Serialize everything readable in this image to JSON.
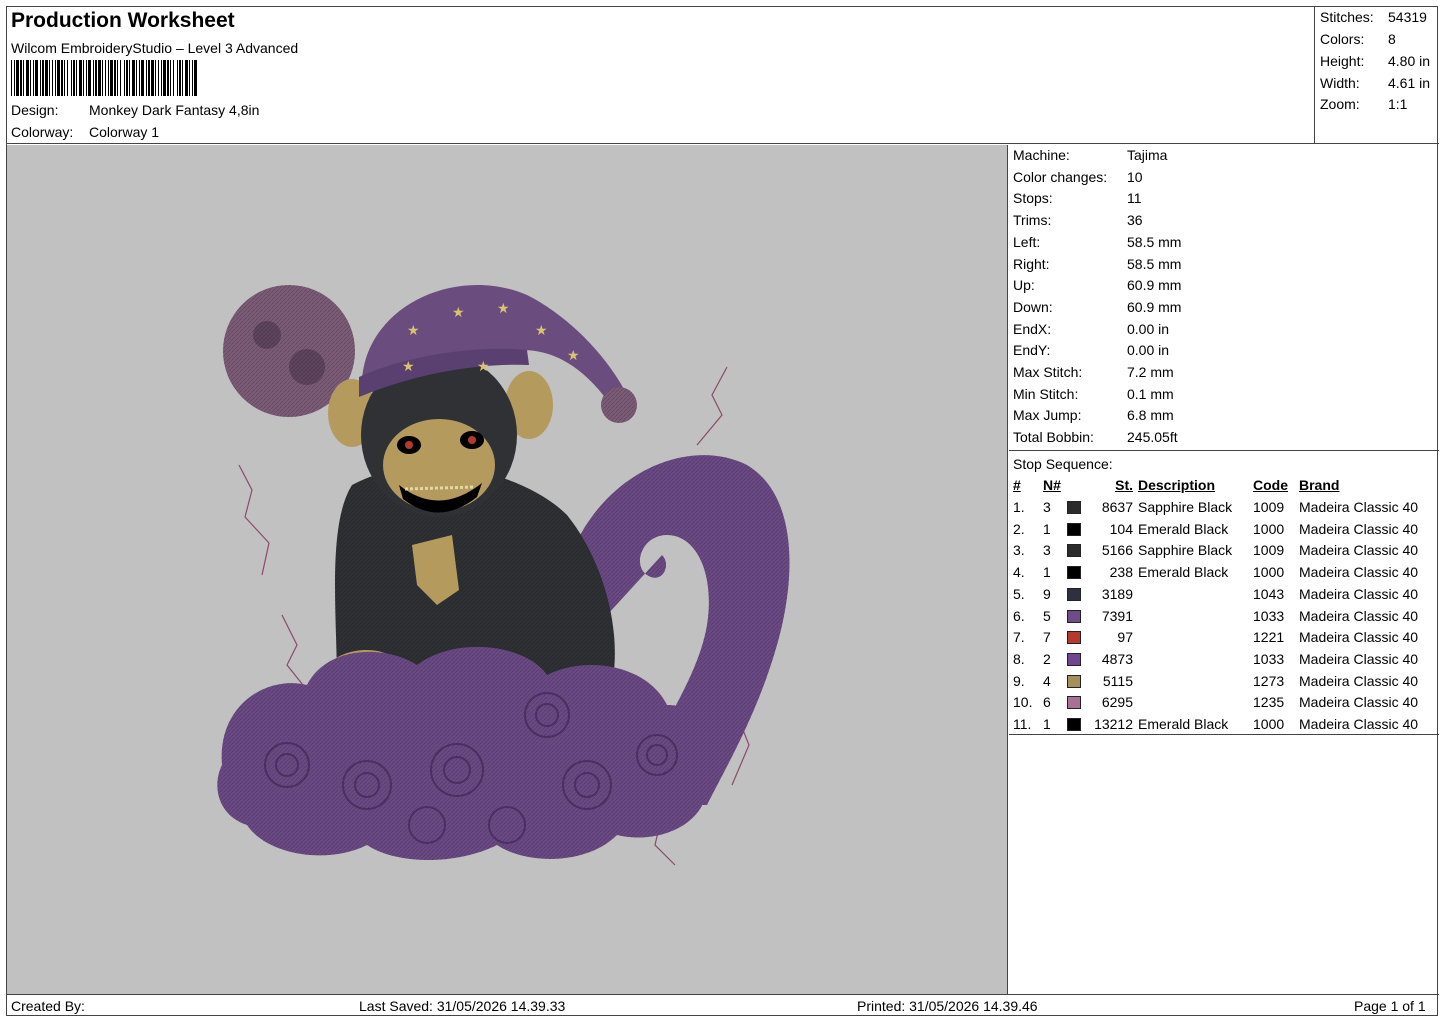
{
  "header": {
    "title": "Production Worksheet",
    "software": "Wilcom EmbroideryStudio – Level 3 Advanced",
    "design_label": "Design:",
    "design_value": "Monkey Dark Fantasy 4,8in",
    "colorway_label": "Colorway:",
    "colorway_value": "Colorway 1"
  },
  "summary": [
    {
      "label": "Stitches:",
      "value": "54319"
    },
    {
      "label": "Colors:",
      "value": "8"
    },
    {
      "label": "Height:",
      "value": "4.80 in"
    },
    {
      "label": "Width:",
      "value": "4.61 in"
    },
    {
      "label": "Zoom:",
      "value": "1:1"
    }
  ],
  "machine": [
    {
      "label": "Machine:",
      "value": "Tajima"
    },
    {
      "label": "Color changes:",
      "value": "10"
    },
    {
      "label": "Stops:",
      "value": "11"
    },
    {
      "label": "Trims:",
      "value": "36"
    },
    {
      "label": "Left:",
      "value": "58.5 mm"
    },
    {
      "label": "Right:",
      "value": "58.5 mm"
    },
    {
      "label": "Up:",
      "value": "60.9 mm"
    },
    {
      "label": "Down:",
      "value": "60.9 mm"
    },
    {
      "label": "EndX:",
      "value": "0.00 in"
    },
    {
      "label": "EndY:",
      "value": "0.00 in"
    },
    {
      "label": "Max Stitch:",
      "value": "7.2 mm"
    },
    {
      "label": "Min Stitch:",
      "value": "0.1 mm"
    },
    {
      "label": "Max Jump:",
      "value": "6.8 mm"
    },
    {
      "label": "Total Bobbin:",
      "value": "245.05ft"
    }
  ],
  "stop_sequence": {
    "title": "Stop Sequence:",
    "headers": {
      "idx": "#",
      "n": "N#",
      "st": "St.",
      "desc": "Description",
      "code": "Code",
      "brand": "Brand"
    },
    "rows": [
      {
        "idx": "1.",
        "n": "3",
        "color": "#2b2b2e",
        "st": "8637",
        "desc": "Sapphire Black",
        "code": "1009",
        "brand": "Madeira Classic 40"
      },
      {
        "idx": "2.",
        "n": "1",
        "color": "#000000",
        "st": "104",
        "desc": "Emerald Black",
        "code": "1000",
        "brand": "Madeira Classic 40"
      },
      {
        "idx": "3.",
        "n": "3",
        "color": "#2b2b2e",
        "st": "5166",
        "desc": "Sapphire Black",
        "code": "1009",
        "brand": "Madeira Classic 40"
      },
      {
        "idx": "4.",
        "n": "1",
        "color": "#000000",
        "st": "238",
        "desc": "Emerald Black",
        "code": "1000",
        "brand": "Madeira Classic 40"
      },
      {
        "idx": "5.",
        "n": "9",
        "color": "#2e3040",
        "st": "3189",
        "desc": "",
        "code": "1043",
        "brand": "Madeira Classic 40"
      },
      {
        "idx": "6.",
        "n": "5",
        "color": "#6e4c88",
        "st": "7391",
        "desc": "",
        "code": "1033",
        "brand": "Madeira Classic 40"
      },
      {
        "idx": "7.",
        "n": "7",
        "color": "#b33a2c",
        "st": "97",
        "desc": "",
        "code": "1221",
        "brand": "Madeira Classic 40"
      },
      {
        "idx": "8.",
        "n": "2",
        "color": "#71468f",
        "st": "4873",
        "desc": "",
        "code": "1033",
        "brand": "Madeira Classic 40"
      },
      {
        "idx": "9.",
        "n": "4",
        "color": "#a58f5c",
        "st": "5115",
        "desc": "",
        "code": "1273",
        "brand": "Madeira Classic 40"
      },
      {
        "idx": "10.",
        "n": "6",
        "color": "#a77195",
        "st": "6295",
        "desc": "",
        "code": "1235",
        "brand": "Madeira Classic 40"
      },
      {
        "idx": "11.",
        "n": "1",
        "color": "#000000",
        "st": "13212",
        "desc": "Emerald Black",
        "code": "1000",
        "brand": "Madeira Classic 40"
      }
    ]
  },
  "footer": {
    "created_by": "Created By:",
    "last_saved": "Last Saved: 31/05/2026 14.39.33",
    "printed": "Printed: 31/05/2026 14.39.46",
    "page": "Page 1 of 1"
  },
  "colors": {
    "preview_bg": "#c1c1c1",
    "moon": "#7d5c78",
    "cloud_purple": "#6c4a85",
    "monkey_dark": "#2f3135",
    "gold": "#b59a5e",
    "eye_red": "#b33a2c"
  }
}
